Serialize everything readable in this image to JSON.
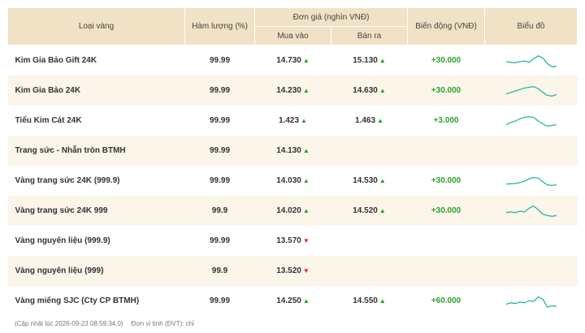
{
  "header": {
    "type_label": "Loại vàng",
    "purity_label": "Hàm lượng (%)",
    "price_group_label": "Đơn giá (nghìn VNĐ)",
    "buy_label": "Mua vào",
    "sell_label": "Bán ra",
    "change_label": "Biến động (VNĐ)",
    "chart_label": "Biểu đồ"
  },
  "rows": [
    {
      "name": "Kim Gia Bảo Gift 24K",
      "purity": "99.99",
      "buy": "14.730",
      "buy_dir": "up",
      "sell": "15.130",
      "sell_dir": "up",
      "change": "+30.000",
      "trend": [
        0.55,
        0.6,
        0.62,
        0.55,
        0.5,
        0.6,
        0.35,
        0.15,
        0.3,
        0.7,
        0.9,
        0.85
      ]
    },
    {
      "name": "Kim Gia Bảo 24K",
      "purity": "99.99",
      "buy": "14.230",
      "buy_dir": "up",
      "sell": "14.630",
      "sell_dir": "up",
      "change": "+30.000",
      "trend": [
        0.7,
        0.6,
        0.5,
        0.4,
        0.3,
        0.25,
        0.2,
        0.35,
        0.6,
        0.8,
        0.85,
        0.75
      ]
    },
    {
      "name": "Tiểu Kim Cát 24K",
      "purity": "99.99",
      "buy": "1.423",
      "buy_dir": "up",
      "sell": "1.463",
      "sell_dir": "up",
      "change": "+3.000",
      "trend": [
        0.75,
        0.6,
        0.5,
        0.35,
        0.25,
        0.2,
        0.25,
        0.5,
        0.7,
        0.85,
        0.8,
        0.75
      ]
    },
    {
      "name": "Trang sức - Nhẫn tròn BTMH",
      "purity": "99.99",
      "buy": "14.130",
      "buy_dir": "up",
      "sell": "",
      "sell_dir": "",
      "change": "",
      "trend": []
    },
    {
      "name": "Vàng trang sức 24K (999.9)",
      "purity": "99.99",
      "buy": "14.030",
      "buy_dir": "up",
      "sell": "14.530",
      "sell_dir": "up",
      "change": "+30.000",
      "trend": [
        0.7,
        0.68,
        0.66,
        0.6,
        0.5,
        0.35,
        0.25,
        0.3,
        0.55,
        0.75,
        0.8,
        0.75
      ]
    },
    {
      "name": "Vàng trang sức 24K 999",
      "purity": "99.9",
      "buy": "14.020",
      "buy_dir": "up",
      "sell": "14.520",
      "sell_dir": "up",
      "change": "+30.000",
      "trend": [
        0.6,
        0.55,
        0.6,
        0.5,
        0.55,
        0.3,
        0.15,
        0.4,
        0.7,
        0.8,
        0.85,
        0.8
      ]
    },
    {
      "name": "Vàng nguyên liệu (999.9)",
      "purity": "99.99",
      "buy": "13.570",
      "buy_dir": "down",
      "sell": "",
      "sell_dir": "",
      "change": "",
      "trend": []
    },
    {
      "name": "Vàng nguyên liệu (999)",
      "purity": "99.9",
      "buy": "13.520",
      "buy_dir": "down",
      "sell": "",
      "sell_dir": "",
      "change": "",
      "trend": []
    },
    {
      "name": "Vàng miếng SJC (Cty CP BTMH)",
      "purity": "99.99",
      "buy": "14.250",
      "buy_dir": "up",
      "sell": "14.550",
      "sell_dir": "up",
      "change": "+60.000",
      "trend": [
        0.7,
        0.6,
        0.65,
        0.55,
        0.6,
        0.45,
        0.5,
        0.2,
        0.35,
        0.9,
        0.8,
        0.85
      ]
    }
  ],
  "footer": {
    "updated": "(Cập nhật lúc 2026-09-23 08:59:34.0)",
    "unit": "Đơn vị tính (ĐVT): chỉ"
  },
  "colors": {
    "header_bg": "#f1e2c5",
    "alt_row": "#fbf5ea",
    "up": "#24a024",
    "down": "#e02020",
    "spark": "#2bb5a0"
  }
}
